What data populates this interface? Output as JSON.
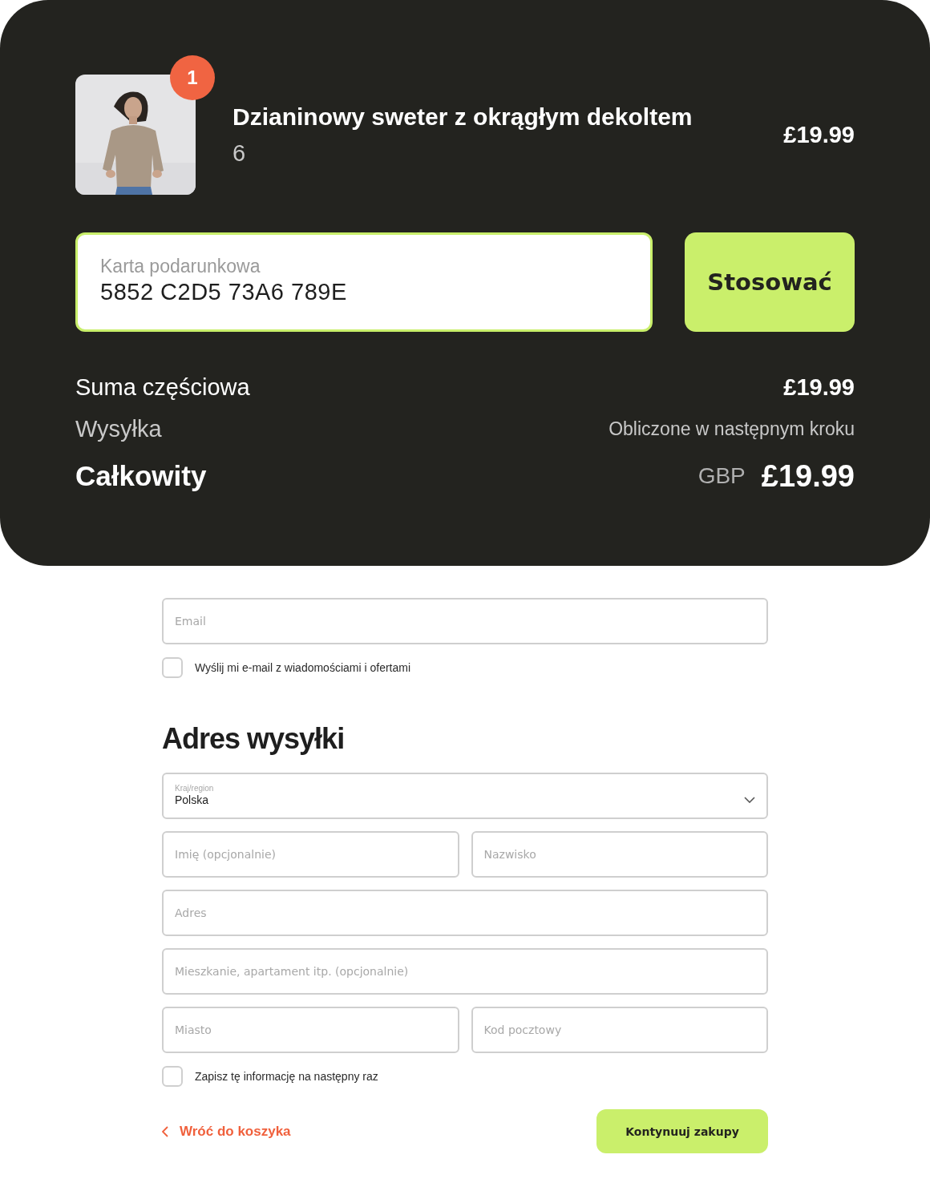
{
  "cart": {
    "items": [
      {
        "name": "Dzianinowy sweter z okrągłym dekoltem",
        "variant": "6",
        "quantity": "1",
        "price": "£19.99"
      }
    ]
  },
  "gift_card": {
    "label": "Karta podarunkowa",
    "value": "5852 C2D5 73A6 789E",
    "button": "Stosować"
  },
  "totals": [
    {
      "kind": "subtotal",
      "label": "Suma częściowa",
      "value": "£19.99"
    },
    {
      "kind": "shipping",
      "label": "Wysyłka",
      "value": "Obliczone w następnym kroku"
    },
    {
      "kind": "total",
      "label": "Całkowity",
      "currency": "GBP",
      "value": "£19.99"
    }
  ],
  "contact": {
    "email": {
      "placeholder": "Email"
    },
    "newsletter": {
      "label": "Wyślij mi e-mail z wiadomościami i ofertami",
      "checked": false
    }
  },
  "shipping": {
    "heading": "Adres wysyłki",
    "country": {
      "label": "Kraj/region",
      "value": "Polska"
    },
    "rows": [
      {
        "fields": [
          {
            "placeholder": "Imię (opcjonalnie)"
          },
          {
            "placeholder": "Nazwisko"
          }
        ]
      },
      {
        "fields": [
          {
            "placeholder": "Adres"
          }
        ]
      },
      {
        "fields": [
          {
            "placeholder": "Mieszkanie, apartament itp. (opcjonalnie)"
          }
        ]
      },
      {
        "fields": [
          {
            "placeholder": "Miasto"
          },
          {
            "placeholder": "Kod pocztowy"
          }
        ]
      }
    ],
    "save_info": {
      "label": "Zapisz tę informację na następny raz",
      "checked": false
    }
  },
  "actions": {
    "back": "Wróć do koszyka",
    "continue": "Kontynuuj zakupy"
  }
}
